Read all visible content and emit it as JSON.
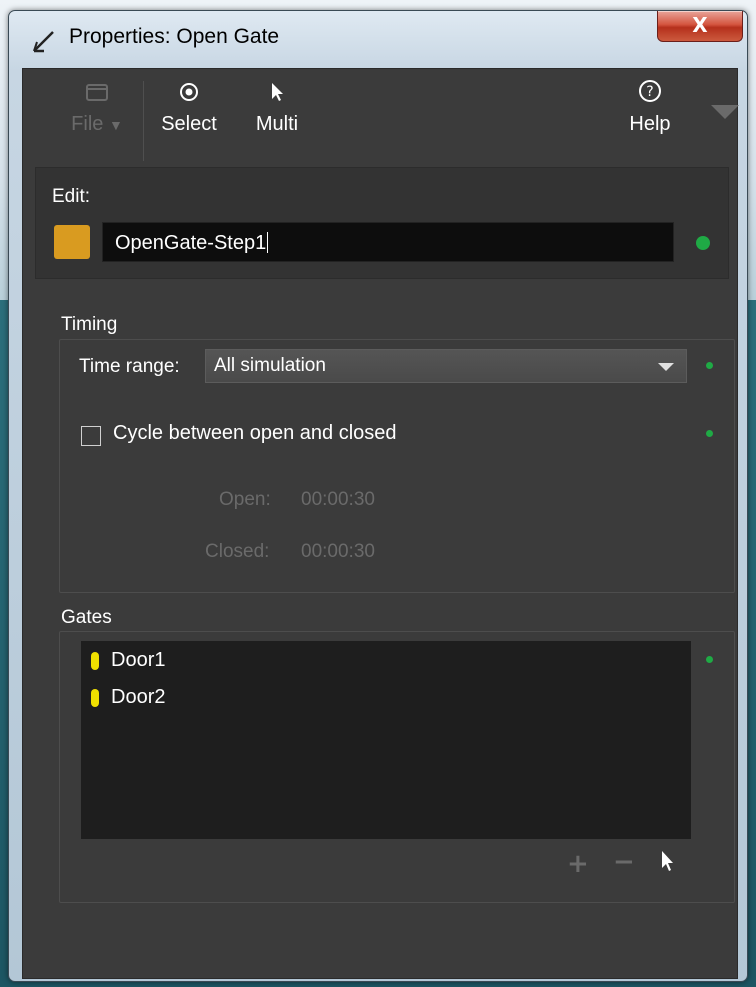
{
  "window": {
    "title": "Properties: Open Gate",
    "close_label": "X"
  },
  "toolbar": {
    "file_label": "File",
    "select_label": "Select",
    "multi_label": "Multi",
    "help_label": "Help"
  },
  "edit": {
    "label": "Edit:",
    "name_value": "OpenGate-Step1",
    "swatch_color": "#d99b20"
  },
  "timing": {
    "group_label": "Timing",
    "time_range_label": "Time range:",
    "time_range_value": "All simulation",
    "cycle_label": "Cycle between open and closed",
    "cycle_checked": false,
    "open_label": "Open:",
    "open_value": "00:00:30",
    "closed_label": "Closed:",
    "closed_value": "00:00:30"
  },
  "gates": {
    "group_label": "Gates",
    "items": [
      {
        "label": "Door1"
      },
      {
        "label": "Door2"
      }
    ]
  },
  "colors": {
    "status_dot": "#1faa45",
    "gate_indicator": "#f0e000",
    "panel_bg": "#3b3b3b"
  }
}
